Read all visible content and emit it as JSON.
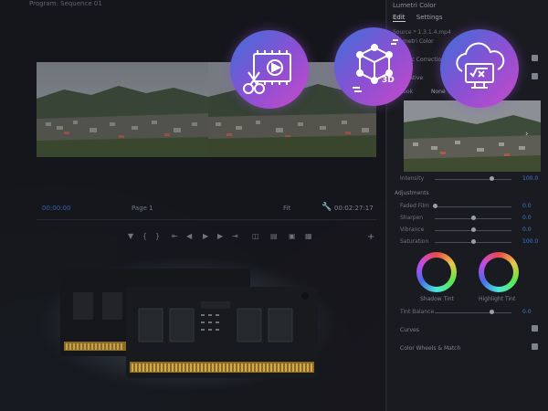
{
  "editor": {
    "sequence_tab": "Program: Sequence 01",
    "left_label": "00:00:00",
    "mid_label": "Page 1",
    "fit": "Fit",
    "timecode": "00:02:27:17"
  },
  "panel": {
    "title": "Lumetri Color",
    "tabs": [
      "Edit",
      "Settings"
    ],
    "source": "Source * 1.3.1.4.mp4",
    "source_link": "Sequence 01 * 1.3.1.4.mp4",
    "preset": "Lumetri Color",
    "rows": {
      "basic_correction": "Basic Correction",
      "creative": "Creative",
      "look": "Look",
      "look_value": "None",
      "intensity": "Intensity",
      "adjustments": "Adjustments",
      "faded_film": "Faded Film",
      "sharpen": "Sharpen",
      "vibrance": "Vibrance",
      "saturation": "Saturation",
      "shadow_tint": "Shadow Tint",
      "highlight_tint": "Highlight Tint",
      "tint_balance": "Tint Balance",
      "curves": "Curves",
      "color_wheels": "Color Wheels & Match"
    },
    "values": {
      "intensity": "100.0",
      "faded_film": "0.0",
      "sharpen": "0.0",
      "vibrance": "0.0",
      "saturation": "100.0",
      "tint_balance": "0.0"
    }
  },
  "icons": [
    "video-edit-icon",
    "3d-cube-icon",
    "cloud-formula-icon"
  ],
  "colors": {
    "accent": "#3a7bd5",
    "icon_gradient_start": "#3d6fd9",
    "icon_gradient_end": "#c64bc9"
  }
}
